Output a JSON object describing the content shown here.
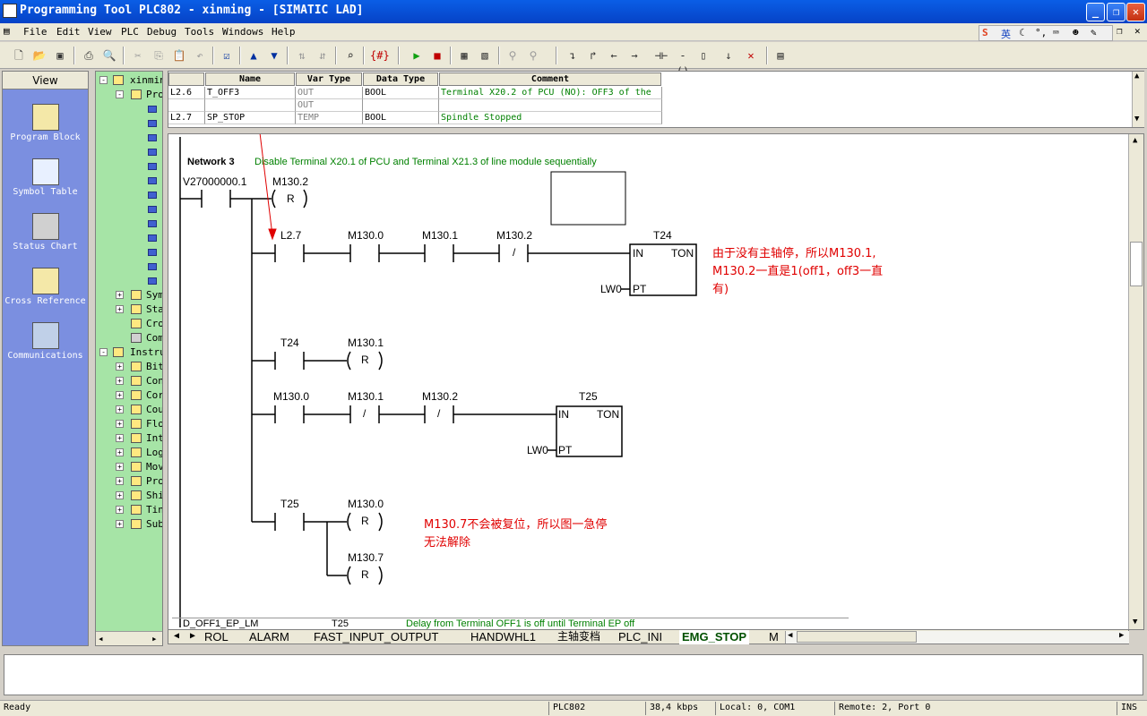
{
  "window": {
    "title": "Programming Tool PLC802 - xinming - [SIMATIC LAD]"
  },
  "menu": [
    "File",
    "Edit",
    "View",
    "PLC",
    "Debug",
    "Tools",
    "Windows",
    "Help"
  ],
  "ime": {
    "label": "英"
  },
  "view_bar": {
    "header": "View",
    "items": [
      "Program Block",
      "Symbol Table",
      "Status Chart",
      "Cross Reference",
      "Communications"
    ]
  },
  "tree": {
    "root": "xinmin",
    "program": "Pro",
    "items": [
      "Sym",
      "Sta",
      "Cro",
      "Com"
    ],
    "instructions": "Instru",
    "instr_items": [
      "Bit",
      "Con",
      "Cor",
      "Cou",
      "Flo",
      "Int",
      "Log",
      "Mov",
      "Pro",
      "Shi",
      "Tin",
      "Sub"
    ]
  },
  "symbol_table": {
    "headers": [
      "Name",
      "Var Type",
      "Data Type",
      "Comment"
    ],
    "rows": [
      {
        "addr": "L2.6",
        "name": "T_OFF3",
        "var": "OUT",
        "type": "BOOL",
        "comment": "Terminal X20.2 of PCU (NO): OFF3 of the"
      },
      {
        "addr": "",
        "name": "",
        "var": "OUT",
        "type": "",
        "comment": ""
      },
      {
        "addr": "L2.7",
        "name": "SP_STOP",
        "var": "TEMP",
        "type": "BOOL",
        "comment": "Spindle Stopped"
      }
    ]
  },
  "ladder": {
    "network_title": "Network 3",
    "network_comment": "Disable Terminal X20.1 of PCU and Terminal X21.3 of line module sequentially",
    "contacts": {
      "v27": "V27000000.1",
      "m1302_coil": "M130.2",
      "coil_r": "R",
      "l27": "L2.7",
      "m1300": "M130.0",
      "m1301": "M130.1",
      "m1302": "M130.2",
      "t24_box": "T24",
      "t24": "T24",
      "m1301_coil": "M130.1",
      "m1300b": "M130.0",
      "m1301b": "M130.1",
      "m1302b": "M130.2",
      "t25_box": "T25",
      "t25": "T25",
      "m1300_coil": "M130.0",
      "m1307_coil": "M130.7"
    },
    "timer": {
      "in": "IN",
      "ton": "TON",
      "pt": "PT",
      "preset": "LW0"
    },
    "not_symbol": "/",
    "annotation1": [
      "由于没有主轴停，所以M130.1,",
      "M130.2一直是1(off1，off3一直",
      "有)"
    ],
    "annotation2": [
      "M130.7不会被复位，所以图一急停",
      "无法解除"
    ],
    "bottom_row": {
      "name": "D_OFF1_EP_LM",
      "timer": "T25",
      "comment": "Delay from Terminal OFF1 is off until Terminal EP off"
    }
  },
  "tabs": [
    "ROL",
    "ALARM",
    "FAST_INPUT_OUTPUT",
    "HANDWHL1",
    "主轴变档",
    "PLC_INI",
    "EMG_STOP",
    "M"
  ],
  "status": {
    "state": "Ready",
    "device": "PLC802",
    "baud": "38,4 kbps",
    "local": "Local: 0, COM1",
    "remote": "Remote: 2, Port 0",
    "mode": "INS"
  },
  "colors": {
    "title": "#0a5ee6",
    "viewbar": "#7b8fe0",
    "tree": "#a6e4a6",
    "annotation": "#e00000",
    "comment": "#008000"
  }
}
